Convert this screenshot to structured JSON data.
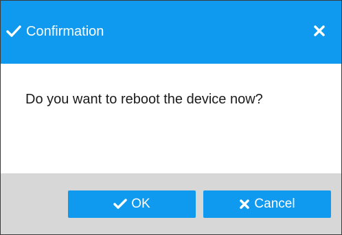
{
  "dialog": {
    "title": "Confirmation",
    "title_icon": "checkmark-icon",
    "close_icon": "close-icon",
    "message": "Do you want to reboot the device now?",
    "buttons": {
      "ok_label": "OK",
      "ok_icon": "checkmark-icon",
      "cancel_label": "Cancel",
      "cancel_icon": "close-icon"
    }
  },
  "colors": {
    "accent": "#0f9aef",
    "footer_background": "#d7d7d7",
    "text": "#1a1a1a"
  }
}
